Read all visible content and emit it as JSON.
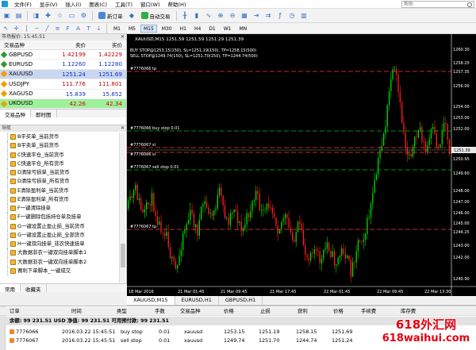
{
  "menu": {
    "items": [
      "文件(F)",
      "显示(V)",
      "插入(I)",
      "图表(C)",
      "工具(T)",
      "窗口(W)",
      "帮助(H)"
    ],
    "search_placeholder": "帮助"
  },
  "toolbar": {
    "new_order": "新订单",
    "auto_trading": "自动交易",
    "timeframes": [
      "M1",
      "M5",
      "M15",
      "M30",
      "H1",
      "H4",
      "D1",
      "W1",
      "MN"
    ],
    "active_timeframe": "M15"
  },
  "market_watch": {
    "title": "市场报价: 15:45:51",
    "col_symbol": "交易品种",
    "col_bid": "卖价",
    "col_ask": "买价",
    "rows": [
      {
        "symbol": "GBPUSD",
        "bid": "1.42199",
        "ask": "1.42229"
      },
      {
        "symbol": "EURUSD",
        "bid": "1.12260",
        "ask": "1.12280"
      },
      {
        "symbol": "XAUUSD",
        "bid": "1251.24",
        "ask": "1251.69"
      },
      {
        "symbol": "USDJPY",
        "bid": "111.776",
        "ask": "111.801"
      },
      {
        "symbol": "XAGUSD",
        "bid": "15.839",
        "ask": "15.852"
      },
      {
        "symbol": "UKOUSD",
        "bid": "42.26",
        "ask": "42.34"
      }
    ],
    "tabs": [
      "交易品种",
      "即时图"
    ]
  },
  "navigator": {
    "title": "导航",
    "items": [
      "B平买单_当前货币",
      "B平卖单_当前货币",
      "C快速平仓_当前货币",
      "C快速平仓_所有货币",
      "D清除亏损单_当前货币",
      "D清除亏损单_所有货币",
      "E清除盈利单_当前货币",
      "E清除盈利单_所有货币",
      "F一键清除挂单",
      "F一键删除包括持仓单及挂单",
      "G一键设置止盈止损_当前货币",
      "G一键设置止盈止损_全部货币",
      "H一键双向挂单_非农快速挂单",
      "大数据非农一键双向挂单脚本1",
      "大数据非农一键双向挂单脚本2",
      "赛利下单脚本_一键成交"
    ],
    "tabs": [
      "常用",
      "收藏夹"
    ]
  },
  "chart": {
    "header": "XAUUSD,M15  1251.59 1251.59 1251.29 1251.39",
    "line_buy_stop": "BUY STOP@1253.15(150), SL=1251.19(150), TP=1258.15(500)",
    "line_sell_stop": "SELL STOP@1249.74(150), SL=1251.70(150), TP=1244.74(500)",
    "current_price": "1251.39",
    "price_labels": [
      "1260.30",
      "1258.25",
      "1257.35",
      "1256.00",
      "1254.00",
      "1253.00",
      "1252.00",
      "1251.39",
      "1250.95",
      "1249.60",
      "1248.00",
      "1247.00",
      "1246.00",
      "1245.00",
      "1244.25",
      "1243.00",
      "1242.00",
      "1240.90"
    ],
    "time_labels": [
      "18 Mar 2016",
      "21 Mar 01:45",
      "21 Mar 09:45",
      "21 Mar 17:45",
      "22 Mar 01:45",
      "22 Mar 09:45",
      "22 Mar 13:30"
    ],
    "order_labels": {
      "tp_top": "#7776066 tp",
      "buy_stop": "#7776066 buy stop 0.01",
      "sl_1": "#7776067 sl",
      "sl_2": "#7776066 sl",
      "sell_stop": "#7776067 sell stop 0.01",
      "tp_bottom": "#7776067 tp"
    }
  },
  "chart_tabs": [
    "XAUUSD,M15",
    "EURUSD,H1",
    "GBPUSD,H1"
  ],
  "terminal": {
    "headers": [
      "订单",
      "时间",
      "类型",
      "手数",
      "交易品种",
      "价格",
      "止损",
      "获利",
      "价格",
      "手续费",
      "库存费"
    ],
    "balance_line": "余额: 99 231.51 USD  净值: 99 231.51  可用预付款: 99 231.51",
    "orders": [
      {
        "order": "7776066",
        "time": "2016.03.22 15:45:51",
        "type": "buy stop",
        "lots": "0.01",
        "symbol": "xauusd",
        "price": "1253.15",
        "sl": "1251.19",
        "tp": "1258.15",
        "cur": "1251.69"
      },
      {
        "order": "7776067",
        "time": "2016.03.22 15:45:51",
        "type": "sell stop",
        "lots": "0.01",
        "symbol": "xauusd",
        "price": "1249.74",
        "sl": "1251.70",
        "tp": "1244.74",
        "cur": "1251.24"
      }
    ]
  },
  "watermark": {
    "line1": "618外汇网",
    "line2": "618waihui.com"
  },
  "colors": {
    "bull": "#00dd00",
    "bear": "#ff2020",
    "grid_red": "#ff3a3a",
    "grid_green": "#00c000",
    "accent": "#e3000f"
  }
}
